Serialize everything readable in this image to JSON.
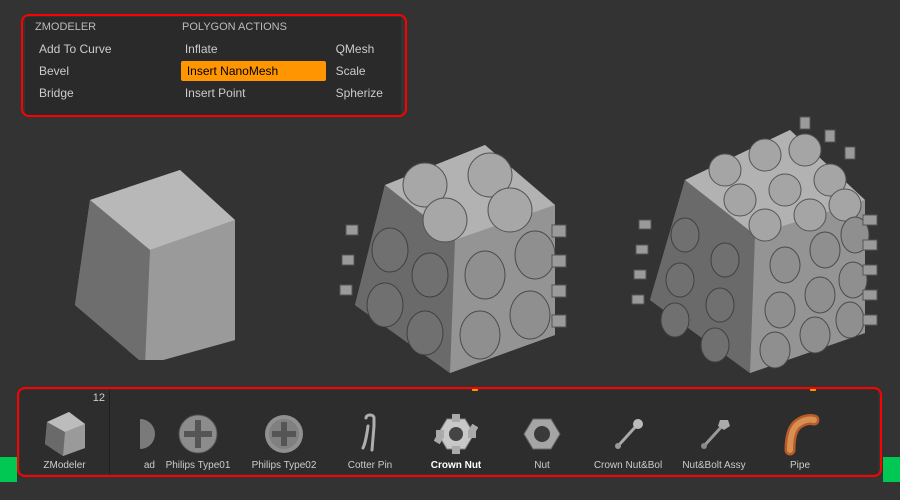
{
  "menu": {
    "header1": "ZMODELER",
    "header2": "POLYGON ACTIONS",
    "col1": [
      "Add To Curve",
      "Bevel",
      "Bridge"
    ],
    "col2": [
      "Inflate",
      "Insert NanoMesh",
      "Insert Point"
    ],
    "col3": [
      "QMesh",
      "Scale",
      "Spherize"
    ],
    "selected": "Insert NanoMesh"
  },
  "toolbar": {
    "main": {
      "label": "ZModeler",
      "badge": "12"
    },
    "items": [
      {
        "label": "ad"
      },
      {
        "label": "Philips Type01"
      },
      {
        "label": "Philips Type02"
      },
      {
        "label": "Cotter Pin"
      },
      {
        "label": "Crown Nut",
        "active": true
      },
      {
        "label": "Nut"
      },
      {
        "label": "Crown Nut&Bol"
      },
      {
        "label": "Nut&Bolt Assy"
      },
      {
        "label": "Pipe"
      }
    ]
  }
}
